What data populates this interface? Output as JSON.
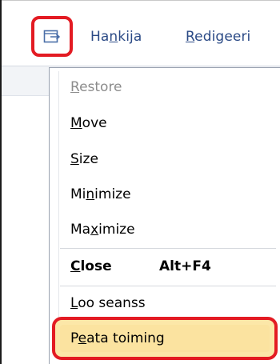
{
  "menubar": {
    "system_icon": "system-menu-icon",
    "items": [
      {
        "label_pre": "Ha",
        "label_key": "n",
        "label_post": "kija"
      },
      {
        "label_pre": "",
        "label_key": "R",
        "label_post": "edigeeri"
      }
    ]
  },
  "system_menu": {
    "items": [
      {
        "pre": "",
        "key": "R",
        "post": "estore",
        "enabled": false
      },
      {
        "pre": "",
        "key": "M",
        "post": "ove",
        "enabled": true
      },
      {
        "pre": "",
        "key": "S",
        "post": "ize",
        "enabled": true
      },
      {
        "pre": "Mi",
        "key": "n",
        "post": "imize",
        "enabled": true
      },
      {
        "pre": "Ma",
        "key": "x",
        "post": "imize",
        "enabled": true
      },
      {
        "pre": "",
        "key": "C",
        "post": "lose",
        "enabled": true,
        "bold": true,
        "accel": "Alt+F4"
      },
      {
        "pre": "",
        "key": "L",
        "post": "oo seanss",
        "enabled": true
      },
      {
        "pre": "P",
        "key": "e",
        "post": "ata toiming",
        "enabled": true,
        "highlighted": true
      }
    ]
  },
  "colors": {
    "annotation_red": "#e31b23",
    "menu_text_blue": "#2b4a86",
    "highlight_fill": "#fce7a8"
  }
}
